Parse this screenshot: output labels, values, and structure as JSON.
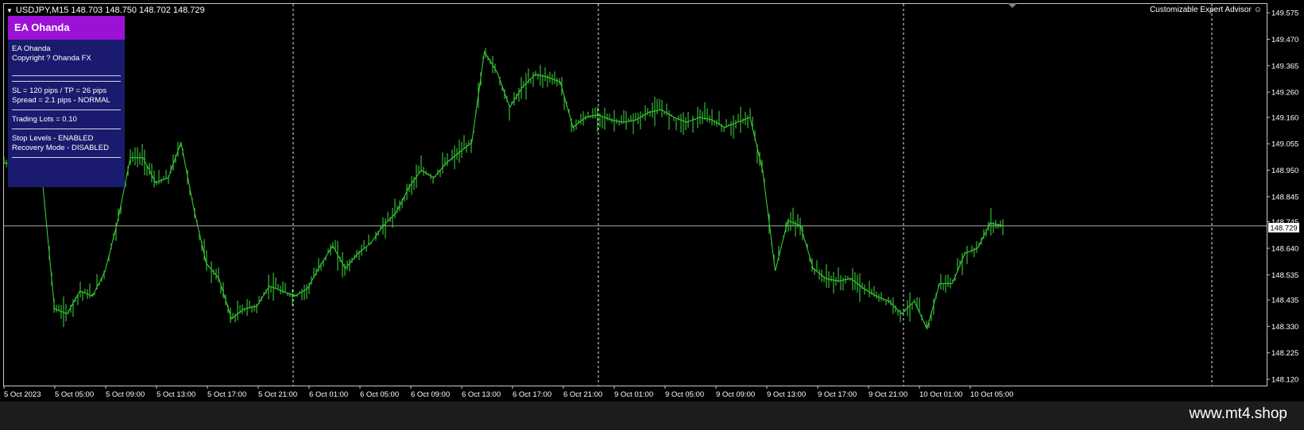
{
  "header": {
    "symbol_line": "USDJPY,M15  148.703 148.750 148.702 148.729",
    "advisor_label": "Customizable Expert Advisor",
    "advisor_icon": "smiley-icon"
  },
  "ea_panel": {
    "title": "EA Ohanda",
    "name": "EA Ohanda",
    "copyright": "Copyright ? Ohanda FX",
    "sl_tp": "SL = 120 pips / TP = 26 pips",
    "spread": "Spread = 2.1 pips - NORMAL",
    "lots": "Trading Lots = 0.10",
    "stop_levels": "Stop Levels - ENABLED",
    "recovery": "Recovery Mode - DISABLED"
  },
  "chart_data": {
    "type": "line",
    "title": "",
    "xlabel": "",
    "ylabel": "",
    "ylim": [
      148.095,
      149.61
    ],
    "y_ticks": [
      "149.575",
      "149.470",
      "149.365",
      "149.260",
      "149.160",
      "149.055",
      "148.950",
      "148.845",
      "148.745",
      "148.640",
      "148.535",
      "148.435",
      "148.330",
      "148.225",
      "148.120"
    ],
    "current_price": "148.729",
    "x_ticks": [
      "5 Oct 2023",
      "5 Oct 05:00",
      "5 Oct 09:00",
      "5 Oct 13:00",
      "5 Oct 17:00",
      "5 Oct 21:00",
      "6 Oct 01:00",
      "6 Oct 05:00",
      "6 Oct 09:00",
      "6 Oct 13:00",
      "6 Oct 17:00",
      "6 Oct 21:00",
      "9 Oct 01:00",
      "9 Oct 05:00",
      "9 Oct 09:00",
      "9 Oct 13:00",
      "9 Oct 17:00",
      "9 Oct 21:00",
      "10 Oct 01:00",
      "10 Oct 05:00"
    ],
    "day_separators": [
      "5 Oct 21:00",
      "6 Oct 21:00",
      "9 Oct 21:00"
    ],
    "series": [
      {
        "x": [
          "5 Oct 2023",
          "5 Oct 01:00",
          "5 Oct 02:00",
          "5 Oct 03:00",
          "5 Oct 04:00",
          "5 Oct 05:00",
          "5 Oct 06:00",
          "5 Oct 07:00",
          "5 Oct 08:00",
          "5 Oct 09:00",
          "5 Oct 10:00",
          "5 Oct 11:00",
          "5 Oct 12:00",
          "5 Oct 13:00",
          "5 Oct 14:00",
          "5 Oct 15:00",
          "5 Oct 16:00",
          "5 Oct 17:00",
          "5 Oct 18:00",
          "5 Oct 19:00",
          "5 Oct 20:00",
          "5 Oct 21:00",
          "5 Oct 22:00",
          "5 Oct 23:00",
          "6 Oct 00:00",
          "6 Oct 01:00",
          "6 Oct 02:00",
          "6 Oct 03:00",
          "6 Oct 04:00",
          "6 Oct 05:00",
          "6 Oct 06:00",
          "6 Oct 07:00",
          "6 Oct 08:00",
          "6 Oct 09:00",
          "6 Oct 10:00",
          "6 Oct 11:00",
          "6 Oct 12:00",
          "6 Oct 13:00",
          "6 Oct 14:00",
          "6 Oct 15:00",
          "6 Oct 16:00",
          "6 Oct 17:00",
          "6 Oct 18:00",
          "6 Oct 19:00",
          "6 Oct 20:00",
          "6 Oct 21:00",
          "6 Oct 22:00",
          "6 Oct 23:00",
          "9 Oct 00:00",
          "9 Oct 01:00",
          "9 Oct 02:00",
          "9 Oct 03:00",
          "9 Oct 04:00",
          "9 Oct 05:00",
          "9 Oct 06:00",
          "9 Oct 07:00",
          "9 Oct 08:00",
          "9 Oct 09:00",
          "9 Oct 10:00",
          "9 Oct 11:00",
          "9 Oct 12:00",
          "9 Oct 13:00",
          "9 Oct 14:00",
          "9 Oct 15:00",
          "9 Oct 16:00",
          "9 Oct 17:00",
          "9 Oct 18:00",
          "9 Oct 19:00",
          "9 Oct 20:00",
          "9 Oct 21:00",
          "9 Oct 22:00",
          "9 Oct 23:00",
          "10 Oct 00:00",
          "10 Oct 01:00",
          "10 Oct 02:00",
          "10 Oct 03:00",
          "10 Oct 04:00",
          "10 Oct 05:00",
          "10 Oct 06:00",
          "10 Oct 07:00"
        ],
        "y": [
          148.98,
          148.97,
          148.99,
          148.93,
          148.4,
          148.38,
          148.47,
          148.45,
          148.55,
          148.75,
          149.0,
          149.0,
          148.9,
          148.92,
          149.06,
          148.8,
          148.58,
          148.52,
          148.36,
          148.4,
          148.41,
          148.49,
          148.47,
          148.45,
          148.48,
          148.57,
          148.65,
          148.56,
          148.62,
          148.66,
          148.73,
          148.78,
          148.88,
          148.95,
          148.92,
          148.98,
          149.02,
          149.06,
          149.42,
          149.34,
          149.2,
          149.28,
          149.33,
          149.32,
          149.3,
          149.12,
          149.16,
          149.17,
          149.15,
          149.14,
          149.15,
          149.18,
          149.19,
          149.16,
          149.14,
          149.16,
          149.15,
          149.12,
          149.14,
          149.16,
          148.95,
          148.55,
          148.75,
          148.73,
          148.56,
          148.52,
          148.51,
          148.52,
          148.48,
          148.45,
          148.43,
          148.38,
          148.43,
          148.32,
          148.5,
          148.5,
          148.62,
          148.64,
          148.74,
          148.73
        ]
      }
    ]
  },
  "watermark": "www.mt4.shop"
}
